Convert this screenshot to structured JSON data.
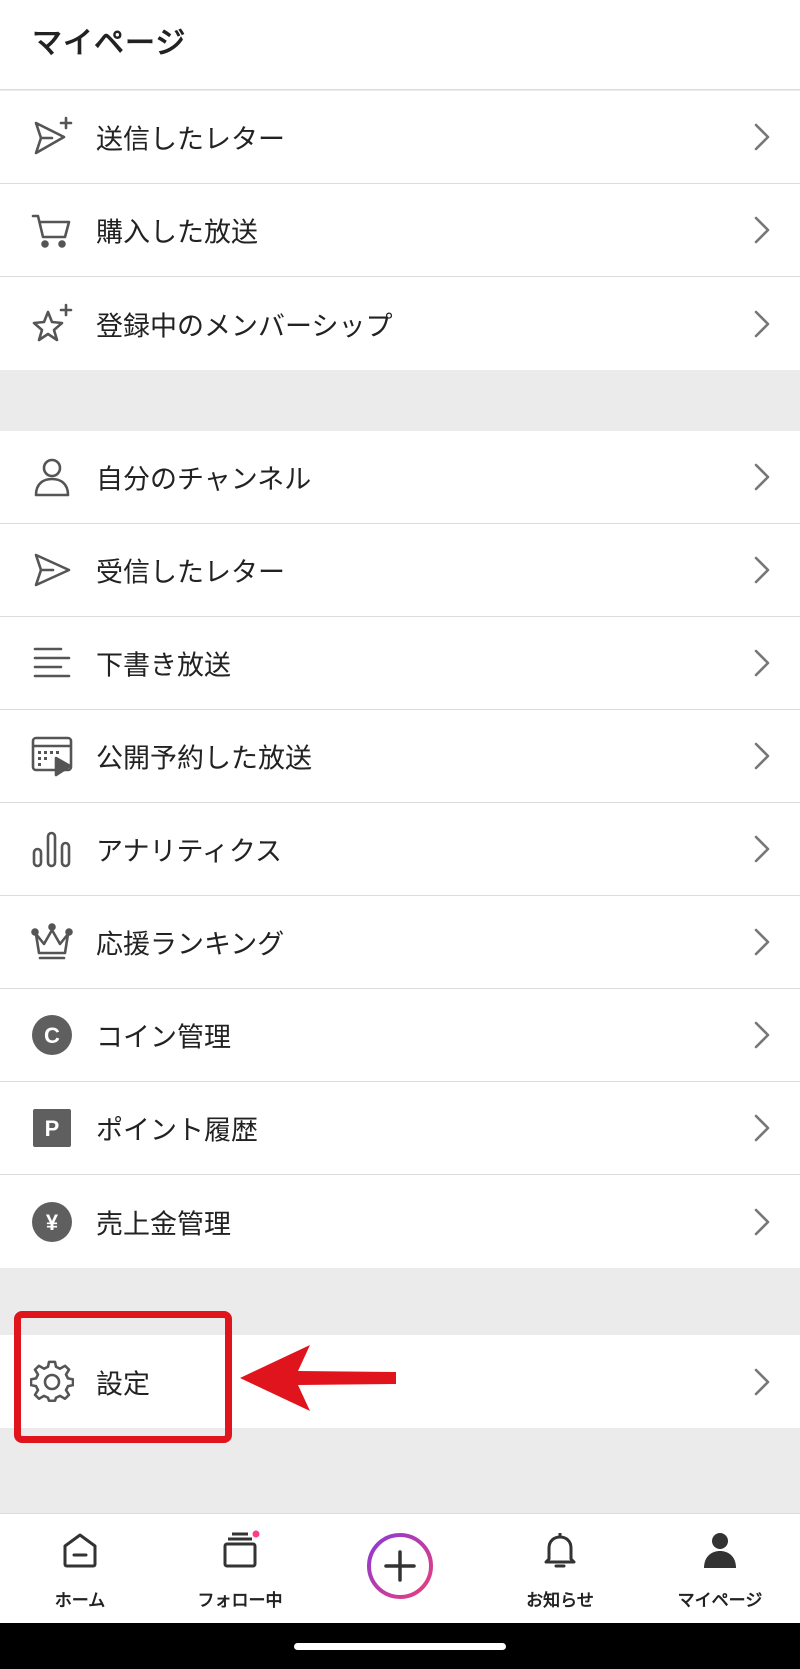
{
  "header": {
    "title": "マイページ"
  },
  "section1": [
    {
      "icon": "send-plus-icon",
      "label": "送信したレター"
    },
    {
      "icon": "cart-icon",
      "label": "購入した放送"
    },
    {
      "icon": "star-plus-icon",
      "label": "登録中のメンバーシップ"
    }
  ],
  "section2": [
    {
      "icon": "person-icon",
      "label": "自分のチャンネル"
    },
    {
      "icon": "send-icon",
      "label": "受信したレター"
    },
    {
      "icon": "lines-icon",
      "label": "下書き放送"
    },
    {
      "icon": "calendar-play-icon",
      "label": "公開予約した放送"
    },
    {
      "icon": "bar-chart-icon",
      "label": "アナリティクス"
    },
    {
      "icon": "crown-icon",
      "label": "応援ランキング"
    },
    {
      "icon": "coin-icon",
      "label": "コイン管理",
      "glyph": "C"
    },
    {
      "icon": "point-icon",
      "label": "ポイント履歴",
      "glyph": "P"
    },
    {
      "icon": "yen-icon",
      "label": "売上金管理",
      "glyph": "¥"
    }
  ],
  "section3": [
    {
      "icon": "gear-icon",
      "label": "設定"
    }
  ],
  "tabbar": {
    "home": "ホーム",
    "following": "フォロー中",
    "notifications": "お知らせ",
    "mypage": "マイページ"
  },
  "colors": {
    "annotation": "#e0141c",
    "icon": "#555555",
    "badge": "#ff3b8a",
    "plus_gradient_start": "#8a3ad6",
    "plus_gradient_end": "#e8407a"
  }
}
